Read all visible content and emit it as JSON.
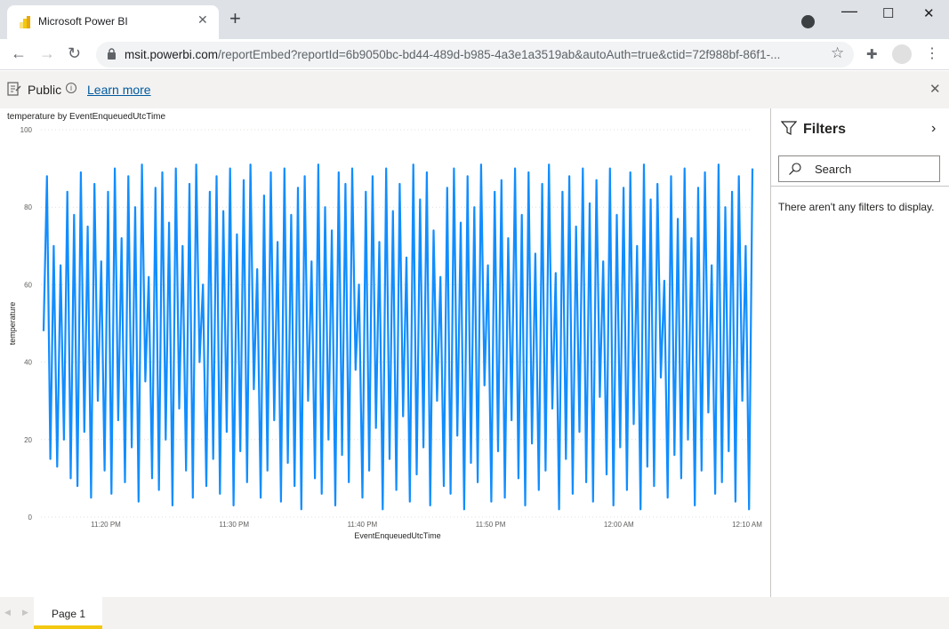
{
  "browser": {
    "tab_title": "Microsoft Power BI",
    "new_tab_label": "+",
    "url_host": "msit.powerbi.com",
    "url_rest": "/reportEmbed?reportId=6b9050bc-bd44-489d-b985-4a3e1a3519ab&autoAuth=true&ctid=72f988bf-86f1-...",
    "icons": [
      "back-icon",
      "forward-icon",
      "reload-icon",
      "lock-icon",
      "star-icon",
      "extensions-icon",
      "profile-icon",
      "menu-icon",
      "minimize-icon",
      "maximize-icon",
      "close-icon"
    ]
  },
  "publish_bar": {
    "label": "Public",
    "link": "Learn more"
  },
  "filters": {
    "title": "Filters",
    "search_placeholder": "Search",
    "empty_message": "There aren't any filters to display."
  },
  "pages": {
    "active": "Page 1"
  },
  "colors": {
    "series": "#118dff",
    "accent_tab": "#f2c811"
  },
  "chart_data": {
    "type": "line",
    "title": "temperature by EventEnqueuedUtcTime",
    "xlabel": "EventEnqueuedUtcTime",
    "ylabel": "temperature",
    "x_ticks": [
      "11:20 PM",
      "11:30 PM",
      "11:40 PM",
      "11:50 PM",
      "12:00 AM",
      "12:10 AM"
    ],
    "y_ticks": [
      "0",
      "20",
      "40",
      "60",
      "80",
      "100"
    ],
    "ylim": [
      0,
      100
    ],
    "x_range": [
      "11:15 PM",
      "12:10 AM"
    ],
    "grid": true,
    "series": [
      {
        "values": [
          48,
          88,
          15,
          70,
          13,
          65,
          20,
          84,
          10,
          78,
          8,
          89,
          22,
          75,
          5,
          86,
          30,
          66,
          12,
          84,
          6,
          90,
          25,
          72,
          9,
          88,
          18,
          80,
          4,
          91,
          35,
          62,
          10,
          85,
          7,
          89,
          20,
          76,
          3,
          90,
          28,
          70,
          12,
          86,
          5,
          91,
          40,
          60,
          8,
          84,
          15,
          88,
          6,
          79,
          22,
          90,
          3,
          73,
          17,
          87,
          9,
          91,
          33,
          64,
          5,
          83,
          12,
          89,
          25,
          71,
          4,
          90,
          14,
          78,
          8,
          85,
          2,
          88,
          30,
          66,
          10,
          91,
          6,
          80,
          20,
          74,
          3,
          89,
          16,
          86,
          9,
          90,
          38,
          60,
          5,
          84,
          12,
          88,
          23,
          71,
          2,
          90,
          15,
          79,
          7,
          86,
          26,
          67,
          4,
          91,
          11,
          82,
          18,
          89,
          3,
          74,
          30,
          62,
          8,
          85,
          6,
          90,
          21,
          76,
          2,
          88,
          14,
          80,
          9,
          91,
          34,
          65,
          4,
          84,
          17,
          87,
          5,
          72,
          25,
          90,
          10,
          78,
          3,
          89,
          19,
          68,
          7,
          86,
          12,
          91,
          28,
          63,
          2,
          84,
          15,
          88,
          6,
          75,
          22,
          90,
          9,
          81,
          4,
          87,
          31,
          66,
          11,
          90,
          3,
          78,
          18,
          85,
          7,
          89,
          24,
          70,
          2,
          91,
          13,
          82,
          8,
          86,
          36,
          61,
          5,
          88,
          16,
          77,
          10,
          90,
          20,
          72,
          3,
          85,
          12,
          89,
          27,
          65,
          6,
          91,
          9,
          80,
          17,
          84,
          4,
          88,
          30,
          70,
          2,
          90
        ]
      }
    ]
  }
}
